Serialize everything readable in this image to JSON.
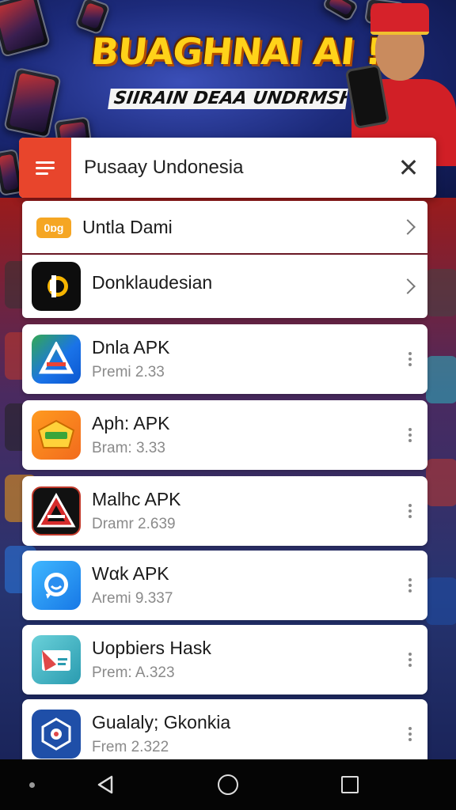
{
  "banner": {
    "title": "BUAGHNAI AI !",
    "subtitle": "SIIRAIN DEAA UNDRMSHKI"
  },
  "search": {
    "value": "Pusaay Undonesia"
  },
  "list": {
    "items": [
      {
        "name": "Untla Dami",
        "badge": "0ɒg",
        "kind": "nav",
        "accent": "#f5a623"
      },
      {
        "name": "Donklaudesian",
        "kind": "nav",
        "accent": "#111111"
      },
      {
        "name": "Dnla APK",
        "version": "Premi 2.33",
        "kind": "app",
        "accent": "#2a7ae2"
      },
      {
        "name": "Aph: APK",
        "version": "Bram: 3.33",
        "kind": "app",
        "accent": "#f39c12"
      },
      {
        "name": "Malhc APK",
        "version": "Dramr 2.639",
        "kind": "app",
        "accent": "#c0392b"
      },
      {
        "name": "Wαk APK",
        "version": "Aremi 9.337",
        "kind": "app",
        "accent": "#1e90ff"
      },
      {
        "name": "Uopbiers Hask",
        "version": "Prem: A.323",
        "kind": "app",
        "accent": "#2bb3c0"
      },
      {
        "name": "Gualaly; Gkonkia",
        "version": "Frem 2.322",
        "kind": "app",
        "accent": "#1f4fa8"
      }
    ]
  },
  "icons": {
    "menu": "hamburger-menu-icon",
    "close": "close-icon",
    "chevron": "chevron-right-icon",
    "more": "more-vertical-icon",
    "back": "nav-back-icon",
    "home": "nav-home-icon",
    "recent": "nav-recent-apps-icon"
  }
}
